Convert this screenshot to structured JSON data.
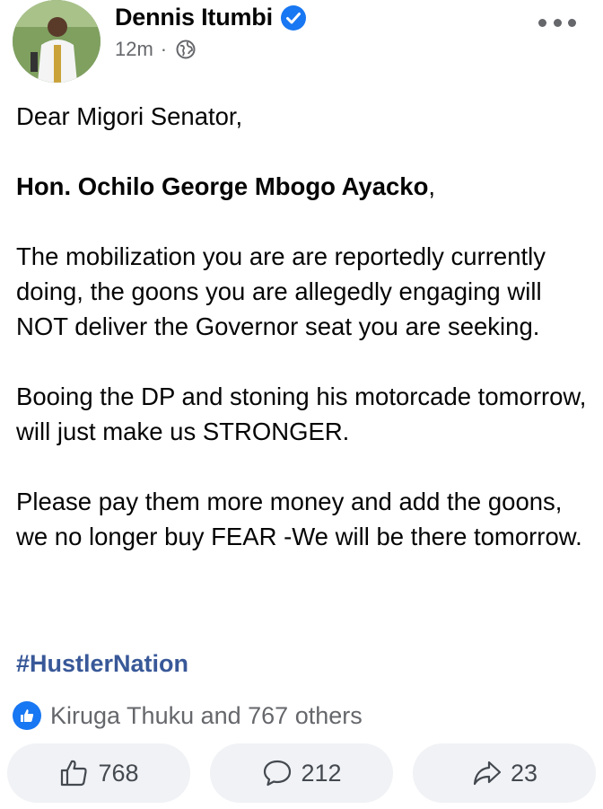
{
  "post": {
    "author": "Dennis Itumbi",
    "time": "12m",
    "separator": "·",
    "paragraphs": {
      "greeting": "Dear Migori Senator,",
      "addressee": "Hon. Ochilo George  Mbogo Ayacko",
      "addressee_suffix": ",",
      "p1": "The mobilization you are are reportedly currently doing, the goons you are allegedly engaging will NOT deliver the Governor seat you are seeking.",
      "p2": "Booing the DP and stoning his motorcade tomorrow, will just make us STRONGER.",
      "p3": "Please pay them more money and add the goons, we no longer buy FEAR -We will be there tomorrow."
    },
    "hashtag": "#HustlerNation"
  },
  "reactions": {
    "summary": "Kiruga Thuku and 767 others"
  },
  "actions": {
    "like_count": "768",
    "comment_count": "212",
    "share_count": "23"
  },
  "icons": {
    "verified": "verified-badge-icon",
    "globe": "globe-icon",
    "more": "more-options-icon",
    "like": "thumbs-up-icon",
    "comment": "comment-icon",
    "share": "share-icon"
  },
  "colors": {
    "brand_blue": "#1877f2",
    "hashtag": "#385898",
    "secondary_text": "#65676b",
    "button_bg": "#f0f2f5"
  }
}
